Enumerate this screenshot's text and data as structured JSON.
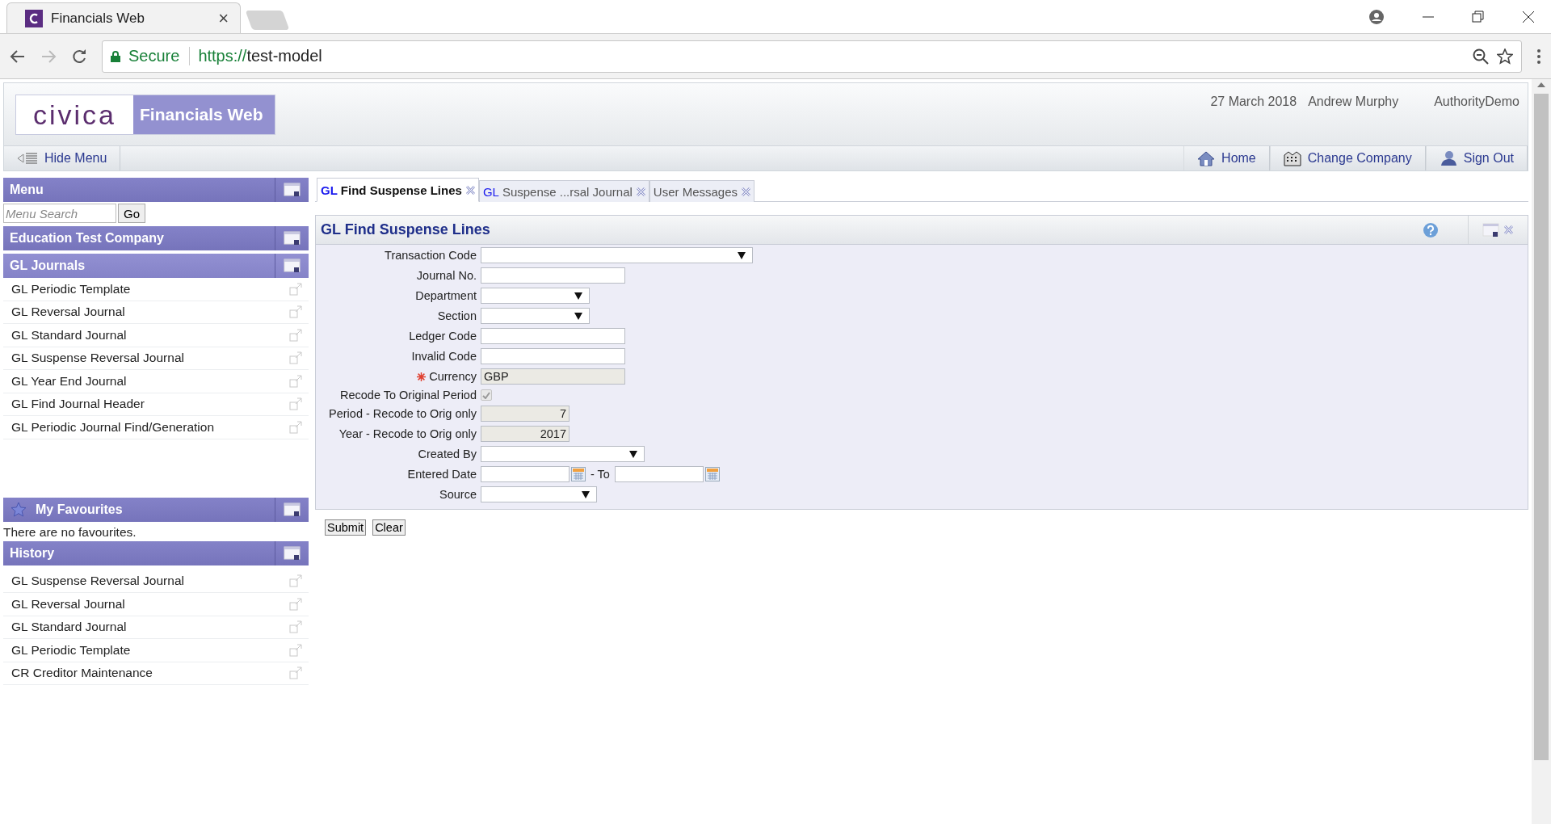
{
  "browser": {
    "tab_title": "Financials Web",
    "tab_close": "×",
    "secure_label": "Secure",
    "url_scheme": "https://",
    "url_host": "test-model"
  },
  "header": {
    "logo": "civica",
    "product": "Financials Web",
    "date": "27 March 2018",
    "user": "Andrew Murphy",
    "authority": "AuthorityDemo"
  },
  "nav": {
    "hide_menu": "Hide Menu",
    "links": [
      {
        "label": "Home",
        "kind": "home"
      },
      {
        "label": "Change Company",
        "kind": "company"
      },
      {
        "label": "Sign Out",
        "kind": "signout"
      }
    ]
  },
  "sidebar": {
    "menu_title": "Menu",
    "search_placeholder": "Menu Search",
    "go": "Go",
    "company": "Education Test Company",
    "group": "GL Journals",
    "items": [
      "GL Periodic Template",
      "GL Reversal Journal",
      "GL Standard Journal",
      "GL Suspense Reversal Journal",
      "GL Year End Journal",
      "GL Find Journal Header",
      "GL Periodic Journal Find/Generation"
    ],
    "favourites_title": "My Favourites",
    "favourites_empty": "There are no favourites.",
    "history_title": "History",
    "history": [
      "GL Suspense Reversal Journal",
      "GL Reversal Journal",
      "GL Standard Journal",
      "GL Periodic Template",
      "CR Creditor Maintenance"
    ]
  },
  "tabs": [
    {
      "prefix": "GL",
      "label": "Find Suspense Lines",
      "selected": true
    },
    {
      "prefix": "GL",
      "label": "Suspense ...rsal Journal",
      "selected": false
    },
    {
      "label": "User Messages",
      "selected": false
    }
  ],
  "form": {
    "title": "GL Find Suspense Lines",
    "fields": [
      {
        "kind": "select",
        "label": "Transaction Code",
        "required": false
      },
      {
        "kind": "text",
        "label": "Journal No.",
        "required": false
      },
      {
        "kind": "select",
        "label": "Department",
        "required": false
      },
      {
        "kind": "select",
        "label": "Section",
        "required": false
      },
      {
        "kind": "text",
        "label": "Ledger Code",
        "required": false
      },
      {
        "kind": "text",
        "label": "Invalid Code",
        "required": false
      },
      {
        "kind": "readonly",
        "label": "Currency",
        "value": "GBP",
        "required": true
      },
      {
        "kind": "checkbox",
        "label": "Recode To Original Period",
        "checked": true,
        "required": false
      },
      {
        "kind": "number",
        "label": "Period - Recode to Orig only",
        "value": "7",
        "required": false
      },
      {
        "kind": "number",
        "label": "Year - Recode to Orig only",
        "value": "2017",
        "required": false
      },
      {
        "kind": "select",
        "label": "Created By",
        "required": false
      },
      {
        "kind": "daterange",
        "label": "Entered Date",
        "to_label": "- To",
        "required": false
      },
      {
        "kind": "select",
        "label": "Source",
        "required": false
      }
    ]
  },
  "buttons": [
    "Submit",
    "Clear"
  ]
}
